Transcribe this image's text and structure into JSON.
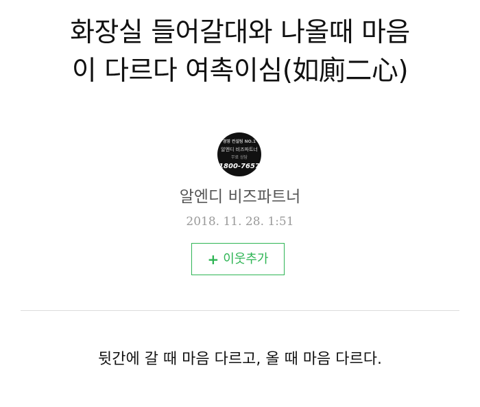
{
  "post": {
    "title_line1": "화장실 들어갈대와 나올때 마음",
    "title_line2": "이 다르다 여촉이심(如廁二心)",
    "author": {
      "name": "알엔디 비즈파트너",
      "avatar_text": {
        "line1": "경영 컨설팅 NO.1",
        "line2": "알엔디 비즈파트너",
        "line3": "무료 상담",
        "line4": "1800-7657"
      }
    },
    "date": "2018. 11. 28. 1:51",
    "follow_button": {
      "plus": "+",
      "label": "이웃추가",
      "color": "#2db453"
    },
    "body_text": "뒷간에 갈 때 마음 다르고, 올 때 마음 다르다."
  }
}
